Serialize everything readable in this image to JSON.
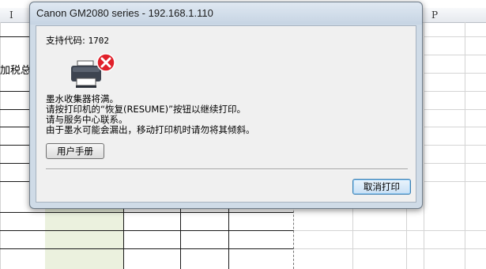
{
  "spreadsheet": {
    "column_headers": [
      "I",
      "P"
    ],
    "partial_cell_text": "加税总"
  },
  "dialog": {
    "title": "Canon GM2080 series - 192.168.1.110",
    "support_code_label": "支持代码:",
    "support_code_value": "1702",
    "icon": "printer-error-icon",
    "message_lines": [
      "墨水收集器将满。",
      "请按打印机的“恢复(RESUME)”按钮以继续打印。",
      "请与服务中心联系。",
      "由于墨水可能会漏出，移动打印机时请勿将其倾斜。"
    ],
    "manual_button_label": "用户手册",
    "cancel_button_label": "取消打印"
  },
  "colors": {
    "error_red": "#e0202a",
    "dialog_frame": "#cfdbe7",
    "selected_cell": "#ebf1de"
  }
}
